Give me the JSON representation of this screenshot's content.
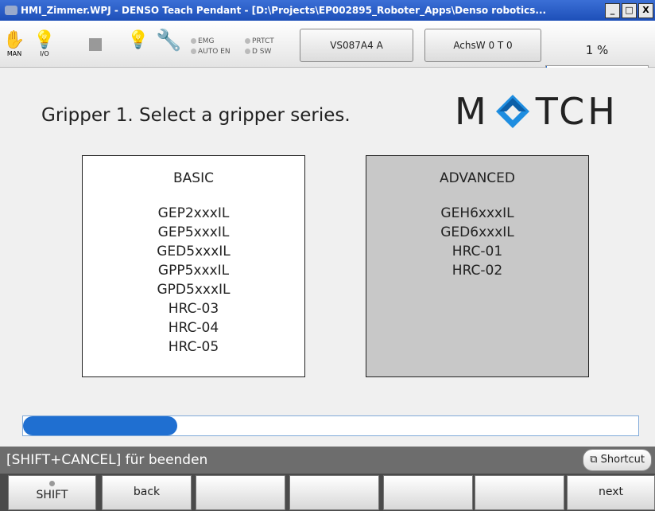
{
  "window": {
    "title": "HMI_Zimmer.WPJ - DENSO Teach Pendant - [D:\\Projects\\EP002895_Roboter_Apps\\Denso robotics...",
    "buttons": [
      "_",
      "□",
      "X"
    ]
  },
  "toolbar": {
    "man_label": "MAN",
    "io_label": "I/O",
    "leds": [
      "EMG",
      "PRTCT",
      "AUTO EN",
      "D SW"
    ],
    "robot_button": "VS087A4 A",
    "axis_button": "AchsW 0 T 0",
    "speed_percent": "1 %",
    "speed_fraction": 0.01
  },
  "main": {
    "heading": "Gripper 1. Select a gripper series.",
    "logo_left": "M",
    "logo_right": "TCH",
    "panels": [
      {
        "title": "BASIC",
        "items": [
          "GEP2xxxIL",
          "GEP5xxxIL",
          "GED5xxxIL",
          "GPP5xxxIL",
          "GPD5xxxIL",
          "HRC-03",
          "HRC-04",
          "HRC-05"
        ]
      },
      {
        "title": "ADVANCED",
        "items": [
          "GEH6xxxIL",
          "GED6xxxIL",
          "HRC-01",
          "HRC-02"
        ]
      }
    ],
    "progress_fraction": 0.25
  },
  "status": {
    "text": "[SHIFT+CANCEL] für beenden",
    "shortcut": "Shortcut"
  },
  "fkeys": [
    "SHIFT",
    "back",
    "",
    "",
    "",
    "",
    "next"
  ],
  "colors": {
    "accent": "#1f6fd1",
    "logo_blue": "#1e8de0",
    "advanced_bg": "#c8c8c8",
    "basic_bg": "#ffffff"
  }
}
